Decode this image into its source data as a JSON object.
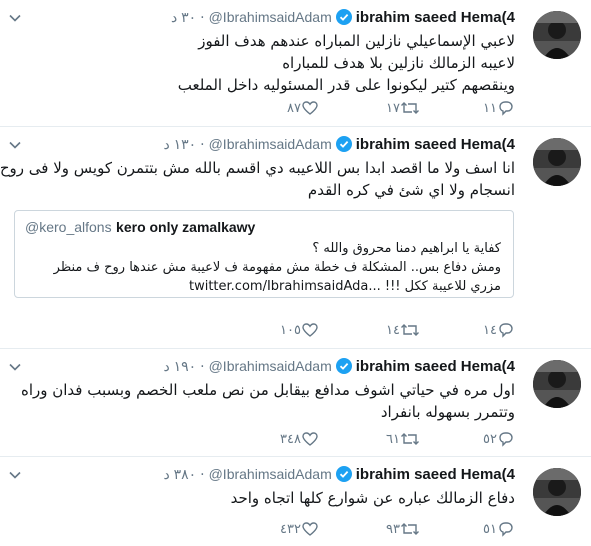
{
  "tweets": [
    {
      "name": "ibrahim saeed Hema(4",
      "handle": "@IbrahimsaidAdam",
      "time": "٣٠ د",
      "lines": [
        "لاعبي الإسماعيلي نازلين المباراه عندهم هدف الفوز",
        "لاعيبه الزمالك نازلين بلا هدف للمباراه",
        "وينقصهم كتير  ليكونوا على قدر المسئوليه داخل الملعب"
      ],
      "reply_count": "١١",
      "retweet_count": "١٧",
      "like_count": "٨٧"
    },
    {
      "name": "ibrahim saeed Hema(4",
      "handle": "@IbrahimsaidAdam",
      "time": "١٣٠ د",
      "lines": [
        "انا اسف ولا ما اقصد ابدا بس اللاعيبه دي اقسم بالله مش بتتمرن كويس ولا فى روح ولا",
        "انسجام ولا اي شئ في كره القدم"
      ],
      "quote": {
        "name": "kero only zamalkawy",
        "handle": "@kero_alfons",
        "lines": [
          "كفاية يا ابراهيم دمنا محروق والله ؟",
          "ومش دفاع بس..  المشكلة ف خطة مش مفهومة ف لاعيبة مش عندها روح ف منظر",
          "مزري للاعيبة ككل !!! ...twitter.com/IbrahimsaidAda"
        ]
      },
      "reply_count": "١٤",
      "retweet_count": "١٤",
      "like_count": "١٠٥"
    },
    {
      "name": "ibrahim saeed Hema(4",
      "handle": "@IbrahimsaidAdam",
      "time": "١٩٠ د",
      "lines": [
        "اول مره في حياتي اشوف مدافع بيقابل من نص ملعب الخصم وبسبب فدان وراه",
        "وتتمرر بسهوله بانفراد"
      ],
      "reply_count": "٥٢",
      "retweet_count": "٦١",
      "like_count": "٣٤٨"
    },
    {
      "name": "ibrahim saeed Hema(4",
      "handle": "@IbrahimsaidAdam",
      "time": "٣٨٠ د",
      "lines": [
        "دفاع الزمالك عباره عن شوارع كلها اتجاه واحد"
      ],
      "reply_count": "٥١",
      "retweet_count": "٩٣",
      "like_count": "٤٣٢"
    }
  ],
  "colors": {
    "verified": "#1da1f2",
    "meta_gray": "#657786",
    "border": "#e6ecf0"
  },
  "icons": {
    "reply": "reply-icon",
    "retweet": "retweet-icon",
    "like": "heart-icon",
    "more": "chevron-down-icon",
    "verified": "verified-badge-icon"
  }
}
